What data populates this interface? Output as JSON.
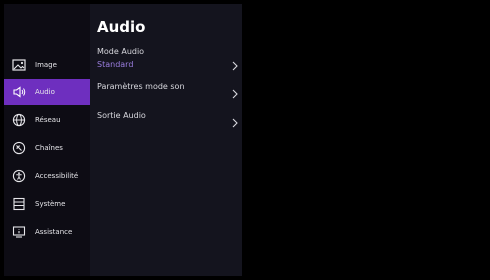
{
  "sidebar": {
    "items": [
      {
        "label": "Image",
        "icon": "image-icon"
      },
      {
        "label": "Audio",
        "icon": "speaker-icon",
        "active": true
      },
      {
        "label": "Réseau",
        "icon": "globe-icon"
      },
      {
        "label": "Chaînes",
        "icon": "channels-icon"
      },
      {
        "label": "Accessibilité",
        "icon": "accessibility-icon"
      },
      {
        "label": "Système",
        "icon": "system-icon"
      },
      {
        "label": "Assistance",
        "icon": "assistance-icon"
      }
    ]
  },
  "panel": {
    "title": "Audio",
    "settings": [
      {
        "label": "Mode Audio",
        "value": "Standard"
      },
      {
        "label": "Paramètres mode son"
      },
      {
        "label": "Sortie Audio"
      }
    ]
  },
  "colors": {
    "accent": "#6e2fbf",
    "value_text": "#9b7ee0",
    "sidebar_bg": "#0d0c14",
    "panel_bg": "#14141e"
  }
}
